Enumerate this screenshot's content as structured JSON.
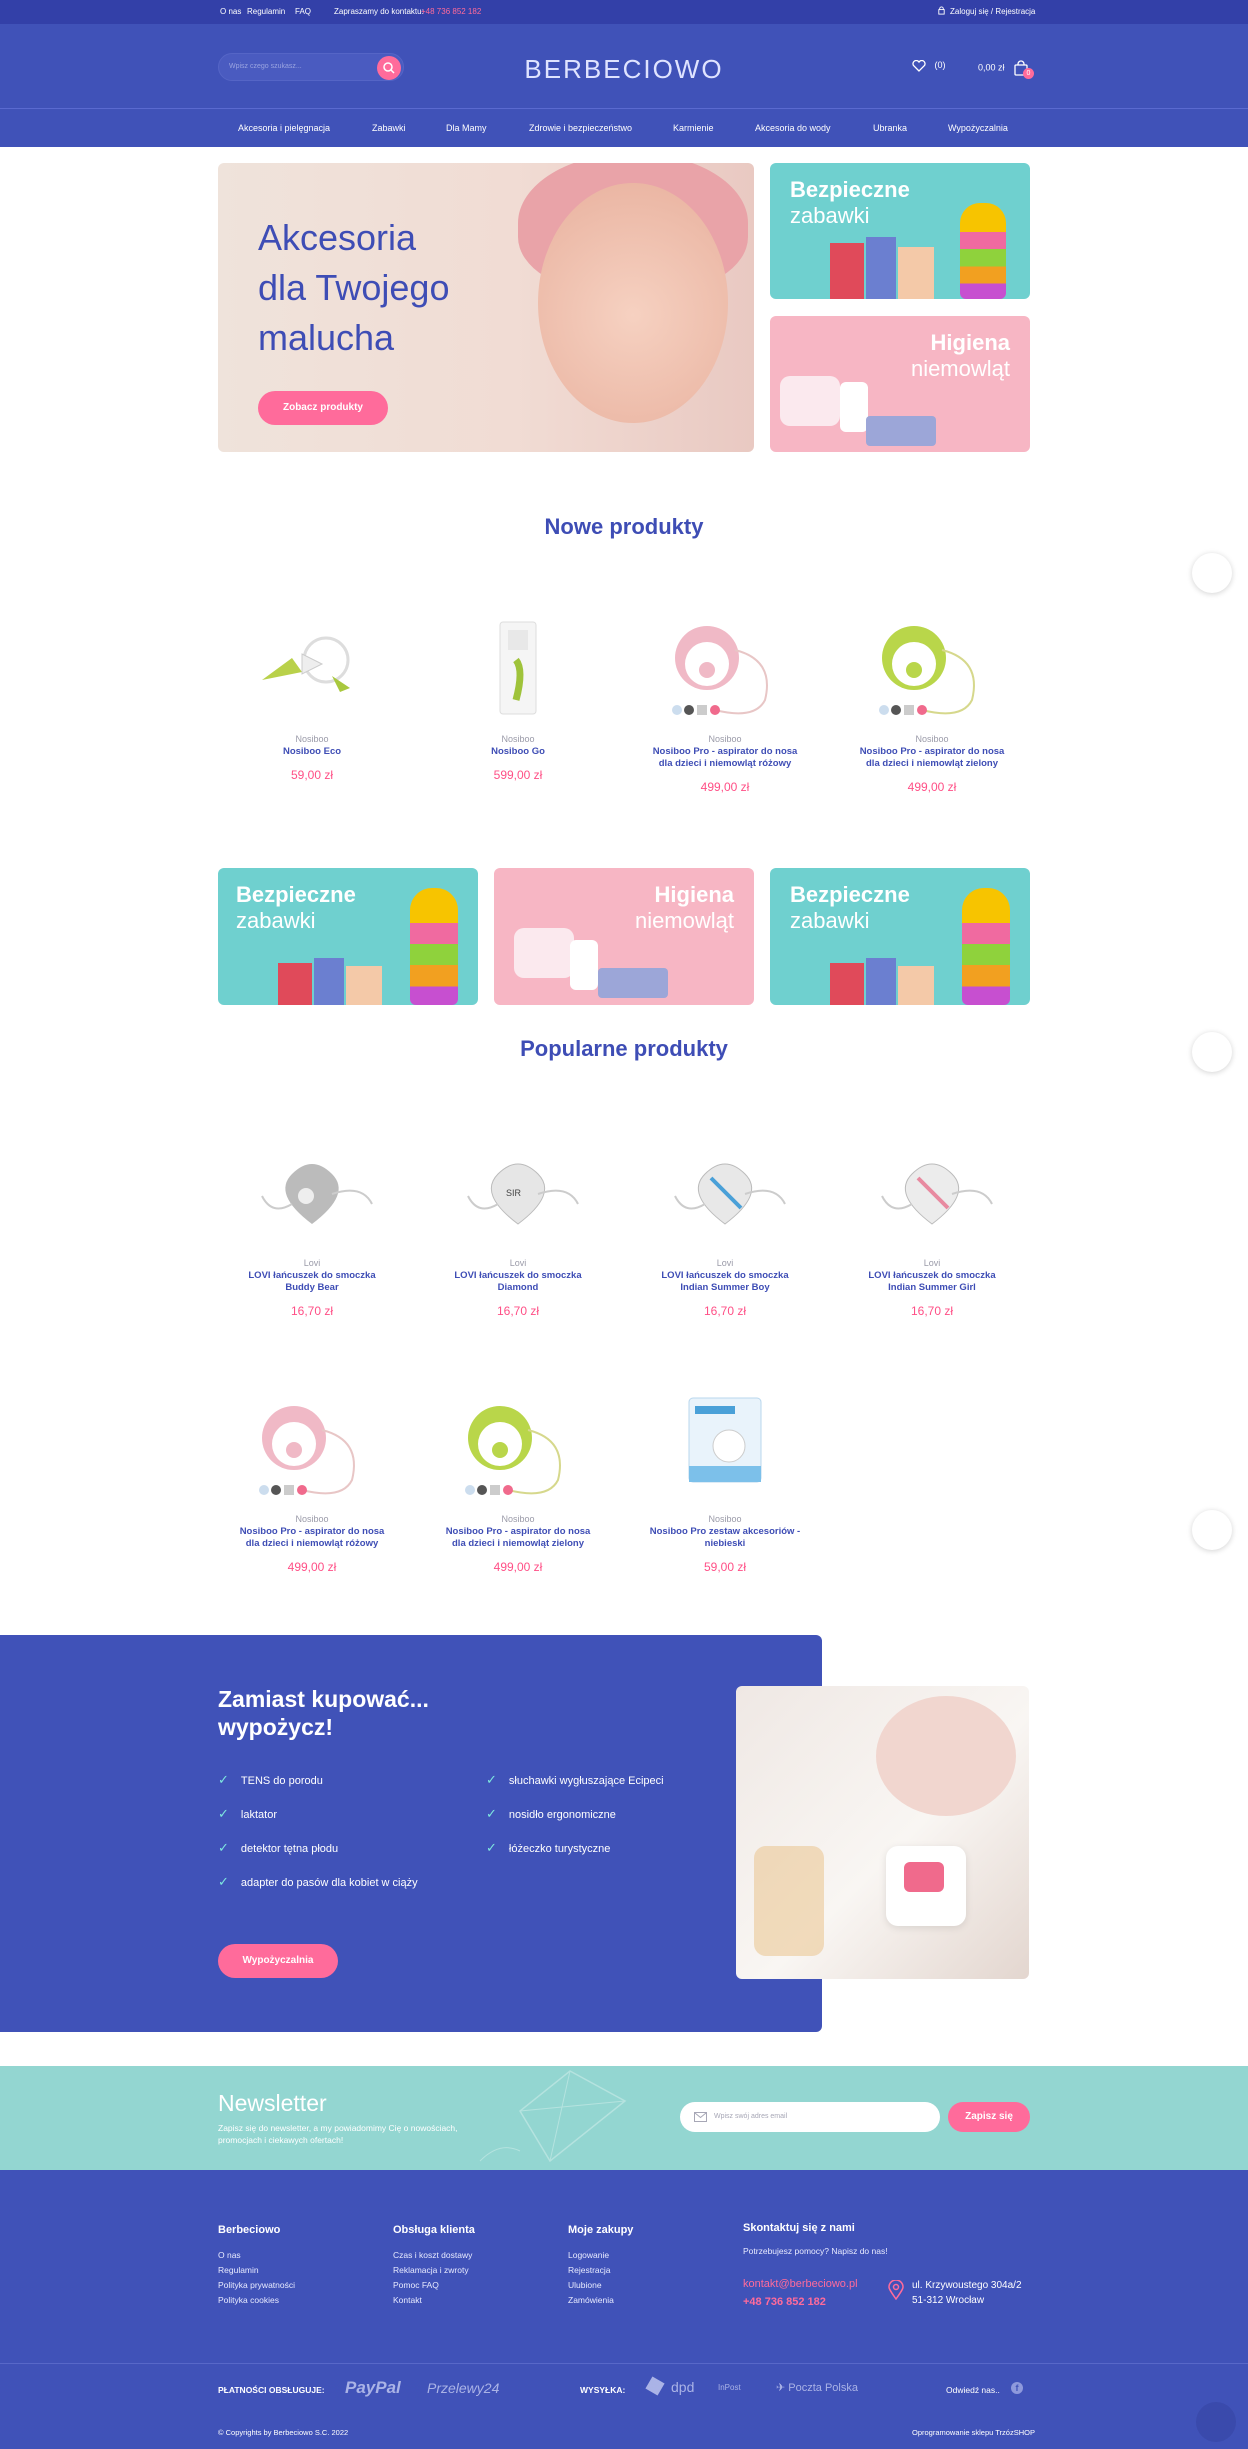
{
  "topbar": {
    "links": [
      "O nas",
      "Regulamin",
      "FAQ"
    ],
    "contact_label": "Zapraszamy do kontaktu:",
    "contact_phone": "+48 736 852 182",
    "login": "Zaloguj się / Rejestracja"
  },
  "header": {
    "search_placeholder": "Wpisz czego szukasz...",
    "logo": "BERBECIOWO",
    "wishlist_count": "(0)",
    "cart_total": "0,00 zł",
    "cart_badge": "0"
  },
  "nav": [
    "Akcesoria i pielęgnacja",
    "Zabawki",
    "Dla Mamy",
    "Zdrowie i bezpieczeństwo",
    "Karmienie",
    "Akcesoria do wody",
    "Ubranka",
    "Wypożyczalnia"
  ],
  "hero": {
    "line1": "Akcesoria",
    "line2": "dla Twojego",
    "line3": "malucha",
    "button": "Zobacz produkty",
    "tile1_a": "Bezpieczne",
    "tile1_b": "zabawki",
    "tile2_a": "Higiena",
    "tile2_b": "niemowląt"
  },
  "new_products": {
    "title": "Nowe produkty",
    "items": [
      {
        "brand": "Nosiboo",
        "name": "Nosiboo Eco",
        "price": "59,00 zł"
      },
      {
        "brand": "Nosiboo",
        "name": "Nosiboo Go",
        "price": "599,00 zł"
      },
      {
        "brand": "Nosiboo",
        "name": "Nosiboo Pro - aspirator do nosa dla dzieci i niemowląt różowy",
        "price": "499,00 zł"
      },
      {
        "brand": "Nosiboo",
        "name": "Nosiboo Pro - aspirator do nosa dla dzieci i niemowląt zielony",
        "price": "499,00 zł"
      }
    ]
  },
  "banners": [
    {
      "a": "Bezpieczne",
      "b": "zabawki"
    },
    {
      "a": "Higiena",
      "b": "niemowląt"
    },
    {
      "a": "Bezpieczne",
      "b": "zabawki"
    }
  ],
  "popular": {
    "title": "Popularne produkty",
    "items": [
      {
        "brand": "Lovi",
        "name": "LOVI łańcuszek do smoczka Buddy Bear",
        "price": "16,70 zł"
      },
      {
        "brand": "Lovi",
        "name": "LOVI łańcuszek do smoczka Diamond",
        "price": "16,70 zł"
      },
      {
        "brand": "Lovi",
        "name": "LOVI łańcuszek do smoczka Indian Summer Boy",
        "price": "16,70 zł"
      },
      {
        "brand": "Lovi",
        "name": "LOVI łańcuszek do smoczka Indian Summer Girl",
        "price": "16,70 zł"
      },
      {
        "brand": "Nosiboo",
        "name": "Nosiboo Pro - aspirator do nosa dla dzieci i niemowląt różowy",
        "price": "499,00 zł"
      },
      {
        "brand": "Nosiboo",
        "name": "Nosiboo Pro - aspirator do nosa dla dzieci i niemowląt zielony",
        "price": "499,00 zł"
      },
      {
        "brand": "Nosiboo",
        "name": "Nosiboo Pro zestaw akcesoriów - niebieski",
        "price": "59,00 zł"
      }
    ]
  },
  "rent": {
    "title_1": "Zamiast kupować...",
    "title_2": "wypożycz!",
    "items_left": [
      "TENS do porodu",
      "laktator",
      "detektor tętna płodu",
      "adapter do pasów dla kobiet w ciąży"
    ],
    "items_right": [
      "słuchawki wygłuszające Ecipeci",
      "nosidło ergonomiczne",
      "łóżeczko turystyczne"
    ],
    "button": "Wypożyczalnia"
  },
  "newsletter": {
    "title": "Newsletter",
    "text": "Zapisz się do newsletter, a my powiadomimy Cię o nowościach, promocjach i ciekawych ofertach!",
    "placeholder": "Wpisz swój adres email",
    "button": "Zapisz się"
  },
  "footer": {
    "col1": {
      "title": "Berbeciowo",
      "links": [
        "O nas",
        "Regulamin",
        "Polityka prywatności",
        "Polityka cookies"
      ]
    },
    "col2": {
      "title": "Obsługa klienta",
      "links": [
        "Czas i koszt dostawy",
        "Reklamacja i zwroty",
        "Pomoc FAQ",
        "Kontakt"
      ]
    },
    "col3": {
      "title": "Moje zakupy",
      "links": [
        "Logowanie",
        "Rejestracja",
        "Ulubione",
        "Zamówienia"
      ]
    },
    "contact": {
      "title": "Skontaktuj się z nami",
      "sub": "Potrzebujesz pomocy? Napisz do nas!",
      "email": "kontakt@berbeciowo.pl",
      "phone": "+48 736 852 182",
      "addr1": "ul. Krzywoustego 304a/2",
      "addr2": "51-312 Wrocław"
    },
    "payments_label": "PŁATNOŚCI OBSŁUGUJE:",
    "pay1": "PayPal",
    "pay2": "Przelewy24",
    "shipping_label": "WYSYŁKA:",
    "ship1": "dpd",
    "ship2": "InPost",
    "ship3": "Poczta Polska",
    "visit": "Odwiedź nas..",
    "copyright": "© Copyrights by Berbeciowo S.C. 2022",
    "software": "Oprogramowanie sklepu TrzózSHOP"
  },
  "colors": {
    "brand": "#4052b8",
    "accent": "#ff6b9b",
    "teal": "#6fd0cf",
    "pink": "#f7b6c4"
  }
}
